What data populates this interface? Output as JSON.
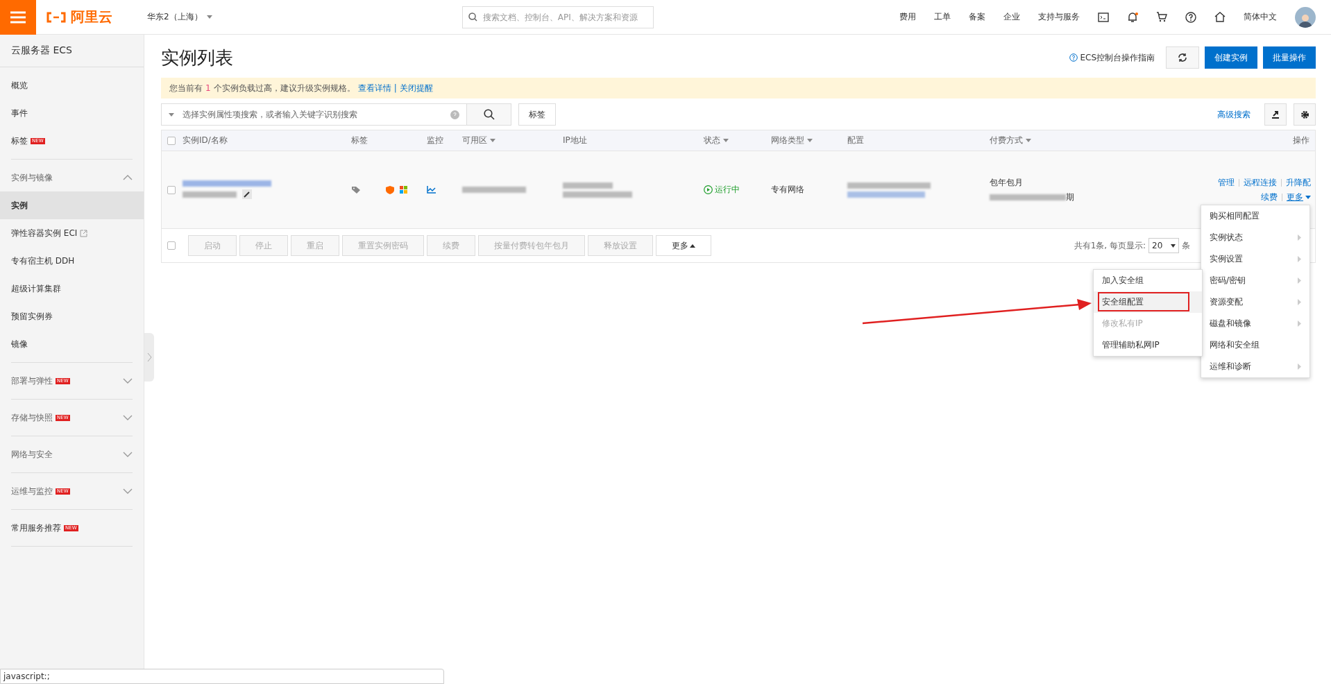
{
  "topbar": {
    "logo": "阿里云",
    "region": "华东2（上海）",
    "search_placeholder": "搜索文档、控制台、API、解决方案和资源",
    "nav": [
      "费用",
      "工单",
      "备案",
      "企业",
      "支持与服务"
    ],
    "language": "简体中文"
  },
  "sidebar": {
    "title": "云服务器 ECS",
    "sections": [
      {
        "kind": "list",
        "items": [
          {
            "label": "概览",
            "selected": false
          },
          {
            "label": "事件",
            "selected": false
          },
          {
            "label": "标签",
            "badge": "NEW",
            "selected": false
          }
        ]
      },
      {
        "kind": "group",
        "label": "实例与镜像",
        "expanded": true,
        "children": [
          {
            "label": "实例",
            "selected": true
          },
          {
            "label": "弹性容器实例 ECI",
            "external": true,
            "selected": false
          },
          {
            "label": "专有宿主机 DDH",
            "selected": false
          },
          {
            "label": "超级计算集群",
            "selected": false
          },
          {
            "label": "预留实例券",
            "selected": false
          },
          {
            "label": "镜像",
            "selected": false
          }
        ]
      },
      {
        "kind": "group",
        "label": "部署与弹性",
        "badge": "NEW",
        "expanded": false
      },
      {
        "kind": "group",
        "label": "存储与快照",
        "badge": "NEW",
        "expanded": false
      },
      {
        "kind": "group",
        "label": "网络与安全",
        "expanded": false
      },
      {
        "kind": "group",
        "label": "运维与监控",
        "badge": "NEW",
        "expanded": false
      },
      {
        "kind": "list",
        "items": [
          {
            "label": "常用服务推荐",
            "badge": "NEW",
            "selected": false
          }
        ]
      }
    ]
  },
  "header": {
    "title": "实例列表",
    "guide": "ECS控制台操作指南",
    "buttons": [
      "创建实例",
      "批量操作"
    ]
  },
  "notice": {
    "prefix": "您当前有",
    "count": "1",
    "suffix": "个实例负载过高，建议升级实例规格。",
    "links": [
      "查看详情",
      "关闭提醒"
    ],
    "separator": "|"
  },
  "filter": {
    "placeholder": "选择实例属性项搜索，或者输入关键字识别搜索",
    "tag_button": "标签",
    "advanced": "高级搜索"
  },
  "table": {
    "header_checked": false,
    "columns": [
      {
        "label": "实例ID/名称",
        "sortable": false
      },
      {
        "label": "标签",
        "sortable": false
      },
      {
        "label": "监控",
        "sortable": false
      },
      {
        "label": "可用区",
        "sortable": true
      },
      {
        "label": "IP地址",
        "sortable": false
      },
      {
        "label": "状态",
        "sortable": true
      },
      {
        "label": "网络类型",
        "sortable": true
      },
      {
        "label": "配置",
        "sortable": false
      },
      {
        "label": "付费方式",
        "sortable": true
      },
      {
        "label": "操作",
        "sortable": false
      }
    ],
    "rows": [
      {
        "checked": false,
        "status": "运行中",
        "network": "专有网络",
        "billing": "包年包月",
        "expiry_tail": "期",
        "actions": [
          "管理",
          "远程连接",
          "升降配"
        ],
        "actions_2": [
          "续费",
          "更多"
        ]
      }
    ]
  },
  "footer": {
    "checked": false,
    "buttons": [
      {
        "label": "启动",
        "disabled": true
      },
      {
        "label": "停止",
        "disabled": true
      },
      {
        "label": "重启",
        "disabled": true
      },
      {
        "label": "重置实例密码",
        "disabled": true
      },
      {
        "label": "续费",
        "disabled": true
      },
      {
        "label": "按量付费转包年包月",
        "disabled": true
      },
      {
        "label": "释放设置",
        "disabled": true
      },
      {
        "label": "更多",
        "disabled": false
      }
    ],
    "total": "共有1条, 每页显示:",
    "page_size": "20",
    "unit": "条"
  },
  "more_menu": [
    {
      "label": "购买相同配置",
      "submenu": false
    },
    {
      "label": "实例状态",
      "submenu": true
    },
    {
      "label": "实例设置",
      "submenu": true
    },
    {
      "label": "密码/密钥",
      "submenu": true
    },
    {
      "label": "资源变配",
      "submenu": true
    },
    {
      "label": "磁盘和镜像",
      "submenu": true
    },
    {
      "label": "网络和安全组",
      "submenu": false
    },
    {
      "label": "运维和诊断",
      "submenu": true
    }
  ],
  "submenu": [
    {
      "label": "加入安全组",
      "selected": false,
      "disabled": false
    },
    {
      "label": "安全组配置",
      "selected": true,
      "disabled": false,
      "annotated": true
    },
    {
      "label": "修改私有IP",
      "selected": false,
      "disabled": true
    },
    {
      "label": "管理辅助私网IP",
      "selected": false,
      "disabled": false
    }
  ],
  "status_tip": "javascript:;"
}
